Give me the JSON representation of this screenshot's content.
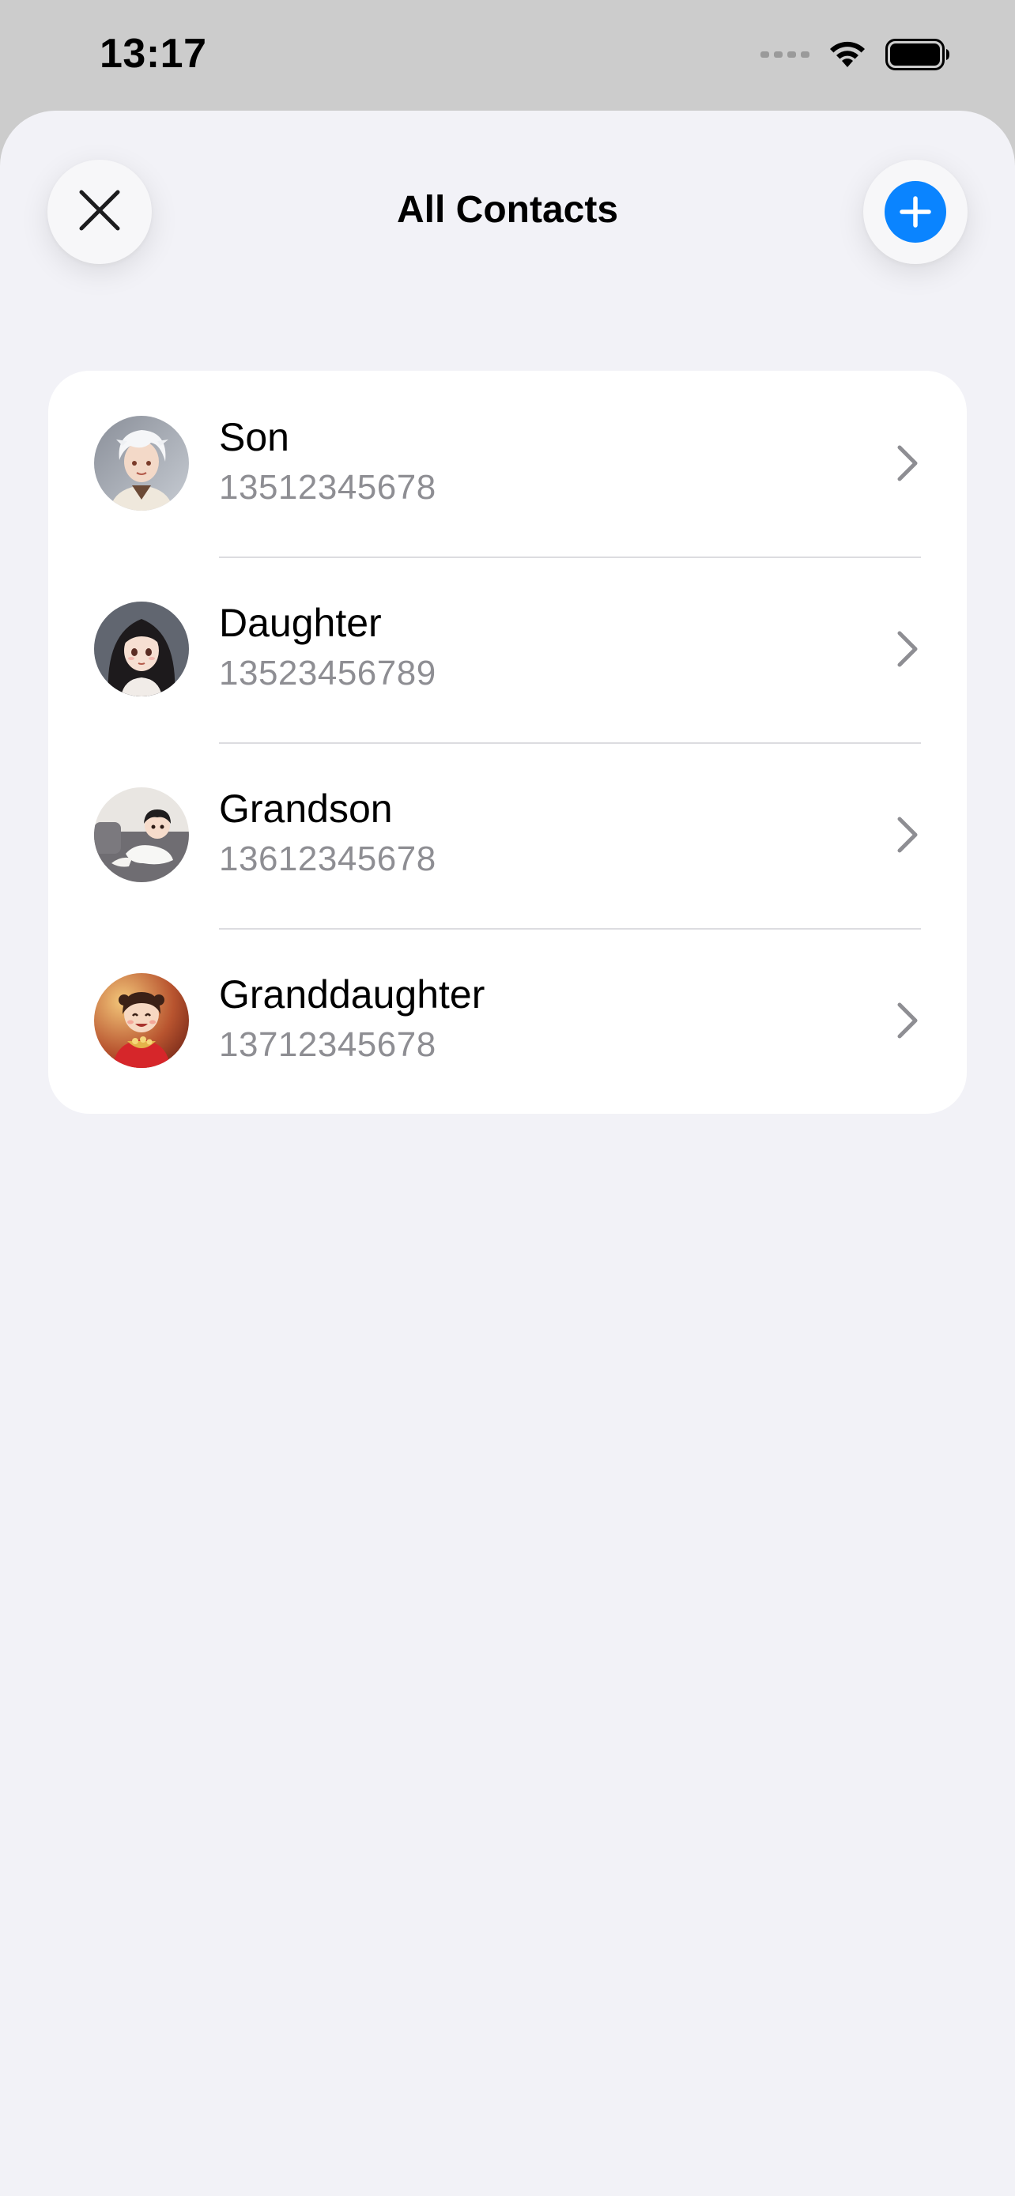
{
  "status_bar": {
    "time": "13:17"
  },
  "nav": {
    "title": "All Contacts",
    "close_icon": "close-icon",
    "add_icon": "plus-circle-icon"
  },
  "colors": {
    "accent": "#0a84ff",
    "sheet_background": "#f2f2f7",
    "secondary_text": "#8e8e93"
  },
  "contacts": [
    {
      "name": "Son",
      "phone": "13512345678",
      "avatar": "son-avatar"
    },
    {
      "name": "Daughter",
      "phone": "13523456789",
      "avatar": "daughter-avatar"
    },
    {
      "name": "Grandson",
      "phone": "13612345678",
      "avatar": "grandson-avatar"
    },
    {
      "name": "Granddaughter",
      "phone": "13712345678",
      "avatar": "granddaughter-avatar"
    }
  ]
}
